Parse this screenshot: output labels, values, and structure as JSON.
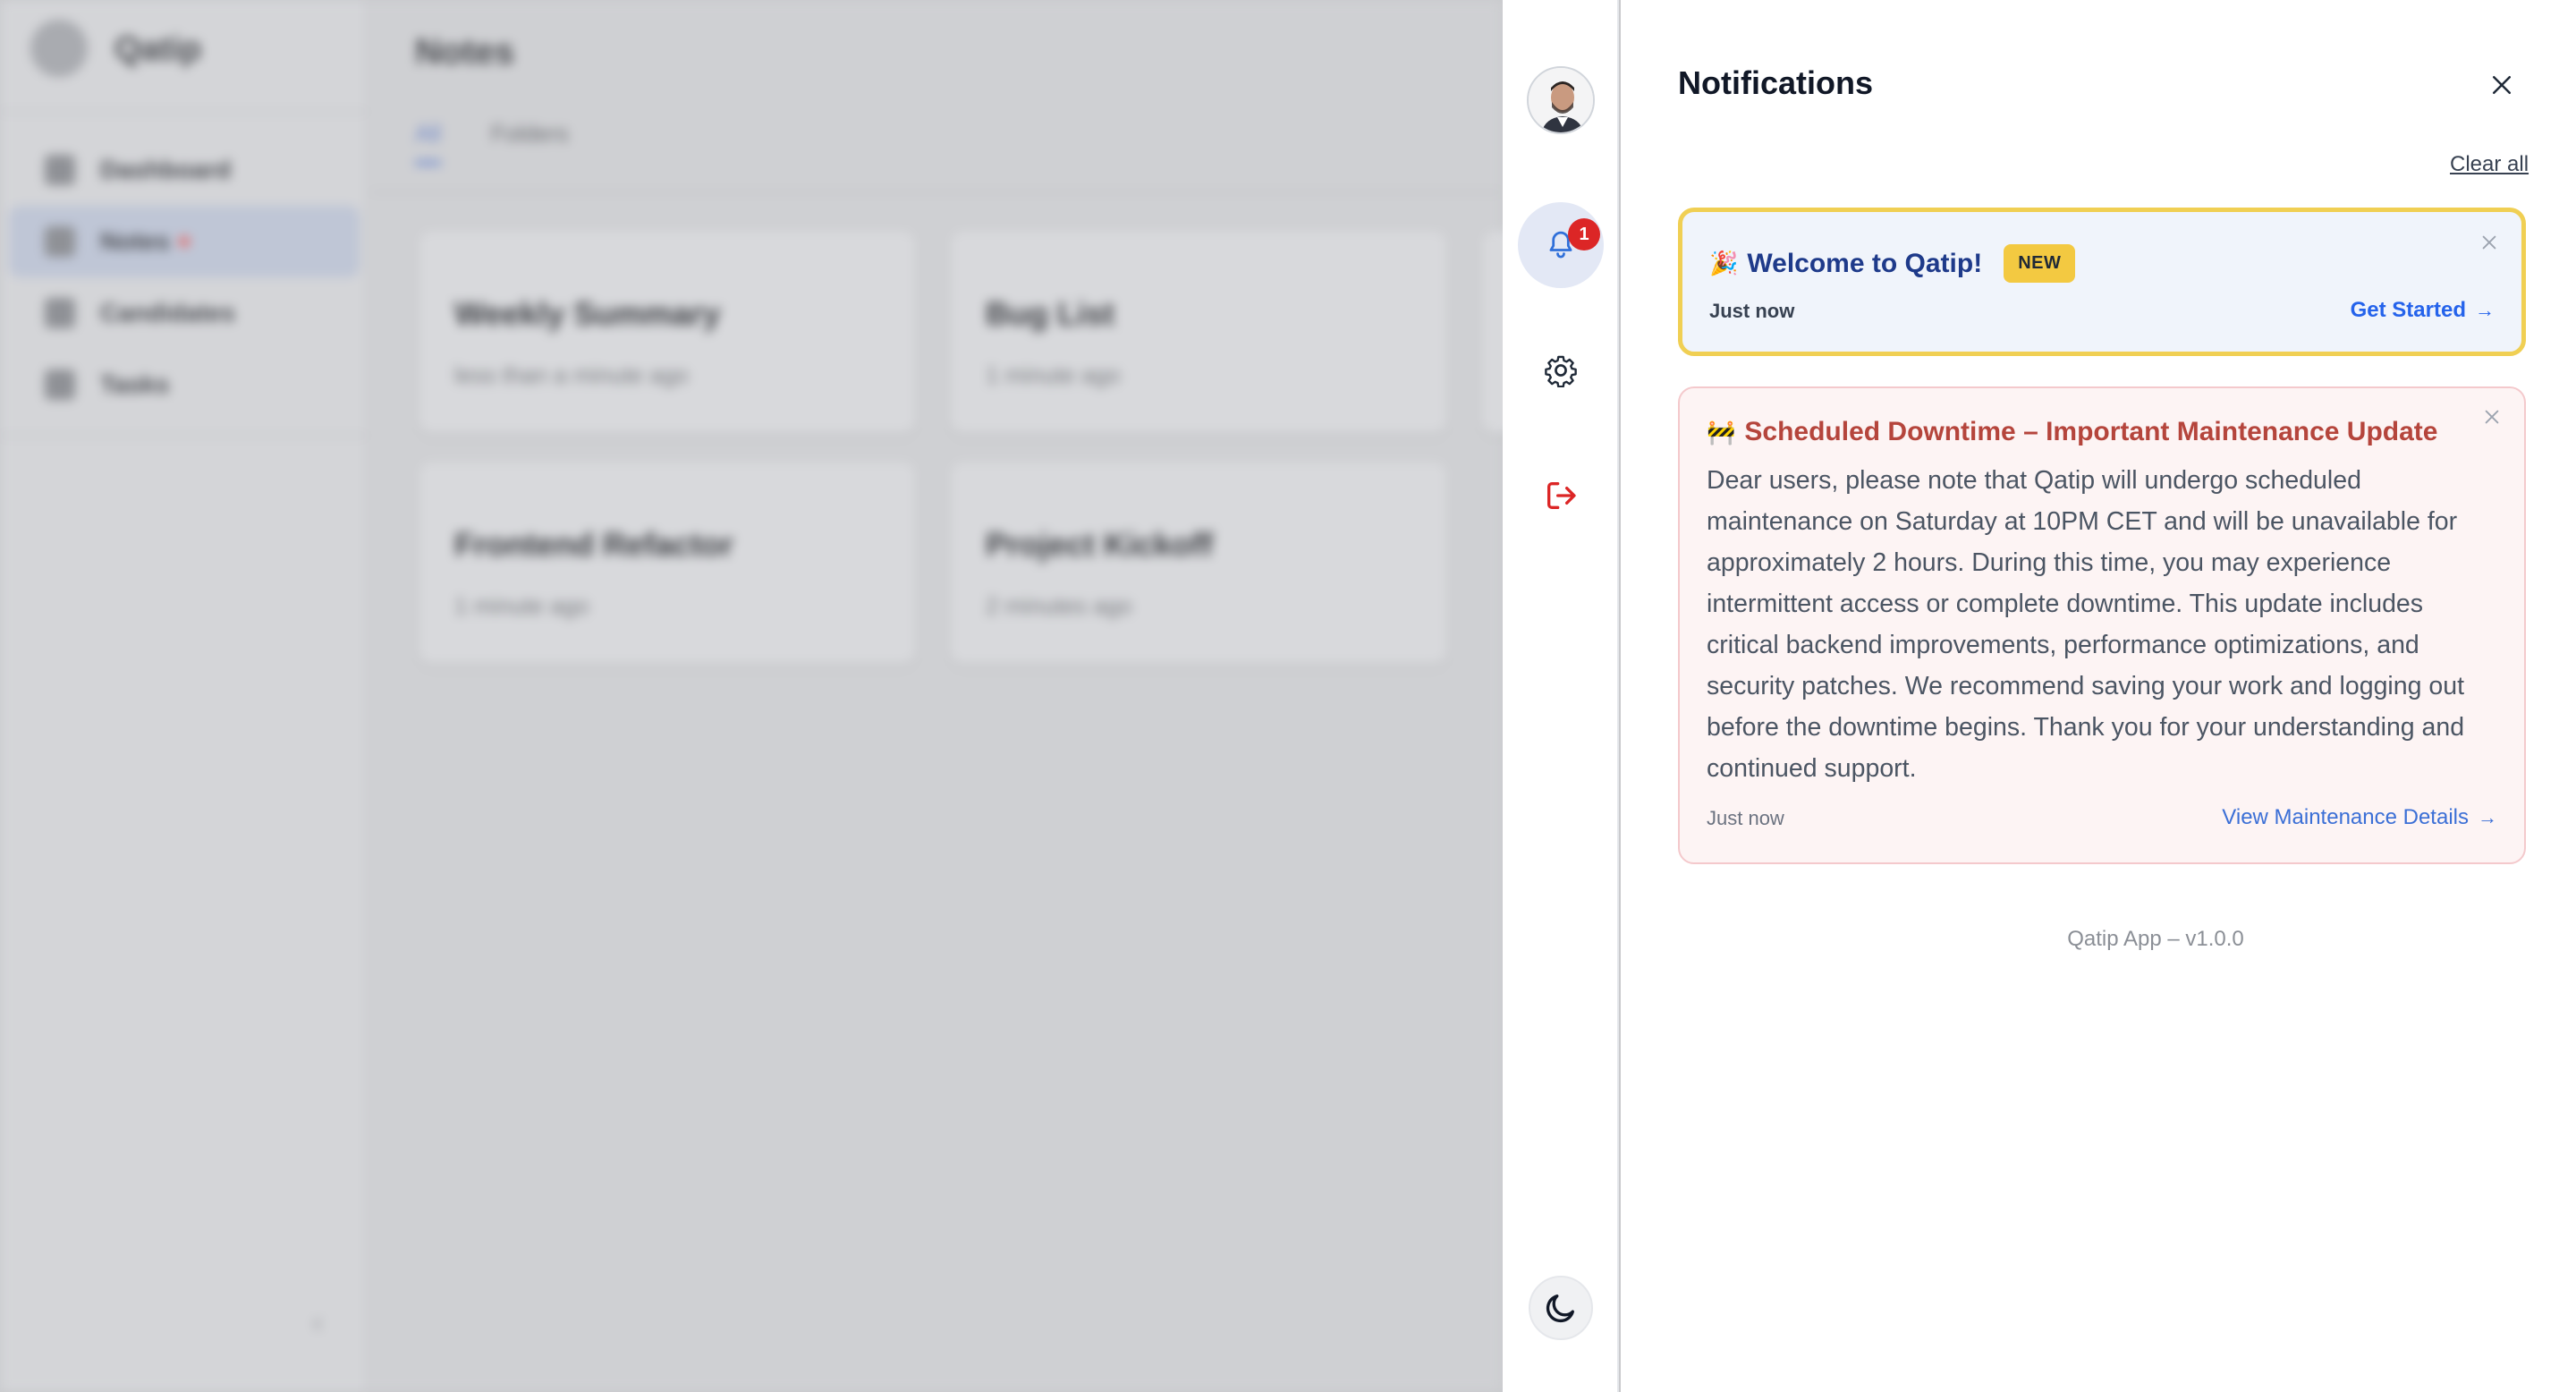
{
  "background_app": {
    "brand": "Qatip",
    "nav": [
      {
        "label": "Dashboard",
        "active": false
      },
      {
        "label": "Notes",
        "active": true,
        "dot": true
      },
      {
        "label": "Candidates",
        "active": false
      },
      {
        "label": "Tasks",
        "active": false
      }
    ],
    "collapse_glyph": "‹",
    "page_title": "Notes",
    "tabs": [
      "All",
      "Folders"
    ],
    "cards": [
      {
        "title": "Weekly Summary",
        "time": "less than a minute ago"
      },
      {
        "title": "Bug List",
        "time": "1 minute ago"
      },
      {
        "title": "Frontend Refactor",
        "time": "1 minute ago"
      },
      {
        "title": "Project Kickoff",
        "time": "2 minutes ago"
      }
    ]
  },
  "rail": {
    "icons": [
      "user-avatar",
      "bell-icon",
      "gear-icon",
      "logout-icon",
      "moon-icon"
    ],
    "notification_count": "1",
    "logout_color": "#dc2626"
  },
  "panel": {
    "title": "Notifications",
    "clear_all": "Clear all",
    "footer": "Qatip App – v1.0.0"
  },
  "notifications": [
    {
      "emoji": "🎉",
      "title": "Welcome to Qatip!",
      "badge": "NEW",
      "time": "Just now",
      "action": "Get Started",
      "accent": "#f0cf53"
    },
    {
      "emoji": "🚧",
      "title": "Scheduled Downtime – Important Maintenance Update",
      "body": "Dear users, please note that Qatip will undergo scheduled maintenance on Saturday at 10PM CET and will be unavailable for approximately 2 hours. During this time, you may experience intermittent access or complete downtime. This update includes critical backend improvements, performance optimizations, and security patches. We recommend saving your work and logging out before the downtime begins. Thank you for your understanding and continued support.",
      "time": "Just now",
      "action": "View Maintenance Details",
      "accent": "#b5453c"
    }
  ]
}
